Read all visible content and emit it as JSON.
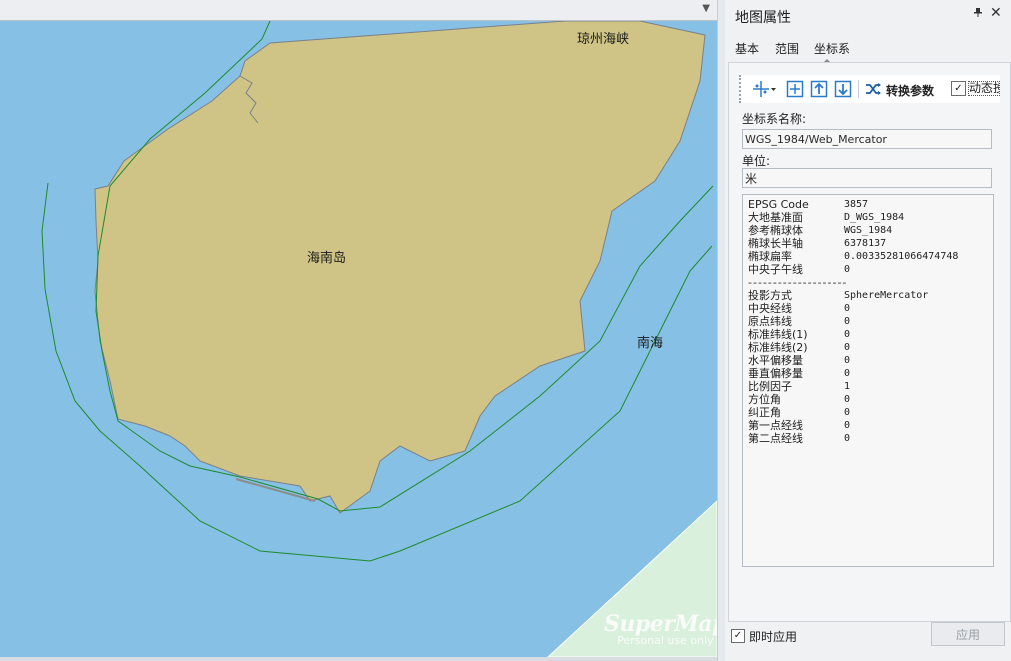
{
  "map": {
    "scroll_arrow": "▼",
    "labels": {
      "qiongzhou_strait": "琼州海峡",
      "hainan_island": "海南岛",
      "south_sea": "南海"
    },
    "watermark": {
      "main": "SuperMap",
      "sub": "Personal use only"
    },
    "colors": {
      "sea": "#86c0e4",
      "land": "#cfc485",
      "coastline": "#7a8089",
      "boundary_line": "#1f8a2c",
      "mainland": "#d8f0dc"
    }
  },
  "panel": {
    "title": "地图属性",
    "pin_icon": "pin-icon",
    "close_icon": "close-icon",
    "tabs": [
      {
        "label": "基本",
        "active": false
      },
      {
        "label": "范围",
        "active": false
      },
      {
        "label": "坐标系",
        "active": true
      }
    ],
    "toolbar": {
      "reproject_icon": "coordinate-system-icon",
      "extent_icon": "extent-icon",
      "import_icon": "import-icon",
      "export_icon": "export-icon",
      "convert_icon": "shuffle-icon",
      "convert_label": "转换参数",
      "dynamic_checked": true,
      "dynamic_label": "动态投影"
    },
    "coord_name_label": "坐标系名称:",
    "coord_name_value": "WGS_1984/Web_Mercator",
    "unit_label": "单位:",
    "unit_value": "米",
    "info_rows": [
      {
        "key": "EPSG Code",
        "value": "3857"
      },
      {
        "key": "大地基准面",
        "value": "D_WGS_1984"
      },
      {
        "key": "参考椭球体",
        "value": "WGS_1984"
      },
      {
        "key": "椭球长半轴",
        "value": "6378137"
      },
      {
        "key": "椭球扁率",
        "value": "0.00335281066474748"
      },
      {
        "key": "中央子午线",
        "value": "0"
      }
    ],
    "separator": "--------------------",
    "projection_rows": [
      {
        "key": "投影方式",
        "value": "SphereMercator"
      },
      {
        "key": "中央经线",
        "value": "0"
      },
      {
        "key": "原点纬线",
        "value": "0"
      },
      {
        "key": "标准纬线(1)",
        "value": "0"
      },
      {
        "key": "标准纬线(2)",
        "value": "0"
      },
      {
        "key": "水平偏移量",
        "value": "0"
      },
      {
        "key": "垂直偏移量",
        "value": "0"
      },
      {
        "key": "比例因子",
        "value": "1"
      },
      {
        "key": "方位角",
        "value": "0"
      },
      {
        "key": "纠正角",
        "value": "0"
      },
      {
        "key": "第一点经线",
        "value": "0"
      },
      {
        "key": "第二点经线",
        "value": "0"
      }
    ],
    "apply_immediately_checked": true,
    "apply_immediately_label": "即时应用",
    "apply_button": "应用"
  }
}
